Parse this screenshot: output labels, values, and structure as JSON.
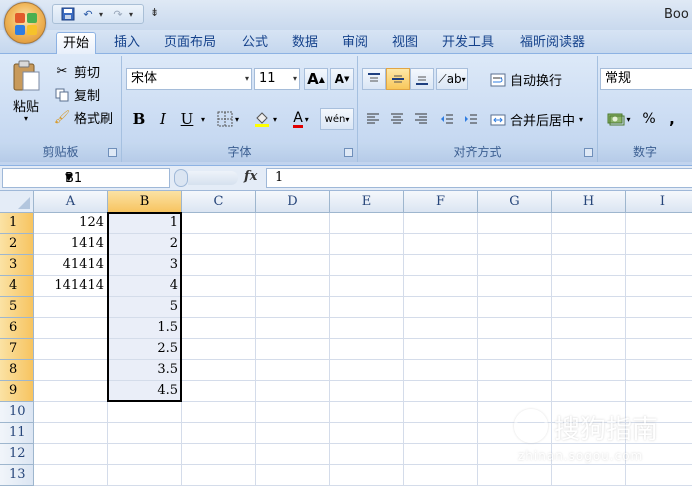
{
  "window": {
    "title": "Boo"
  },
  "quick_access": {
    "more": "⇟"
  },
  "tabs": [
    "开始",
    "插入",
    "页面布局",
    "公式",
    "数据",
    "审阅",
    "视图",
    "开发工具",
    "福昕阅读器"
  ],
  "ribbon": {
    "clipboard": {
      "paste": "粘贴",
      "cut": "剪切",
      "copy": "复制",
      "format_painter": "格式刷",
      "label": "剪贴板"
    },
    "font": {
      "name": "宋体",
      "size": "11",
      "grow": "A",
      "shrink": "A",
      "bold": "B",
      "italic": "I",
      "underline": "U",
      "label": "字体"
    },
    "alignment": {
      "wrap_text": "自动换行",
      "merge_center": "合并后居中",
      "label": "对齐方式"
    },
    "number": {
      "format": "常规",
      "percent": "%",
      "comma": ",",
      "label": "数字"
    }
  },
  "formula_bar": {
    "name_box": "B1",
    "fx": "fx",
    "content": "1"
  },
  "sheet": {
    "columns": [
      "A",
      "B",
      "C",
      "D",
      "E",
      "F",
      "G",
      "H",
      "I"
    ],
    "rows": [
      "1",
      "2",
      "3",
      "4",
      "5",
      "6",
      "7",
      "8",
      "9",
      "10",
      "11",
      "12",
      "13"
    ],
    "colA": [
      "124",
      "1414",
      "41414",
      "141414",
      "",
      "",
      "",
      "",
      "",
      "",
      "",
      "",
      ""
    ],
    "colB": [
      "1",
      "2",
      "3",
      "4",
      "5",
      "1.5",
      "2.5",
      "3.5",
      "4.5",
      "",
      "",
      "",
      ""
    ],
    "selected_column": "B",
    "selected_rows": [
      "1",
      "2",
      "3",
      "4",
      "5",
      "6",
      "7",
      "8",
      "9"
    ]
  },
  "watermark": {
    "main": "搜狗指南",
    "sub": "zhinan.sogou.com"
  },
  "colors": {
    "selection": "#f7c460",
    "ribbon": "#c8daf2"
  }
}
